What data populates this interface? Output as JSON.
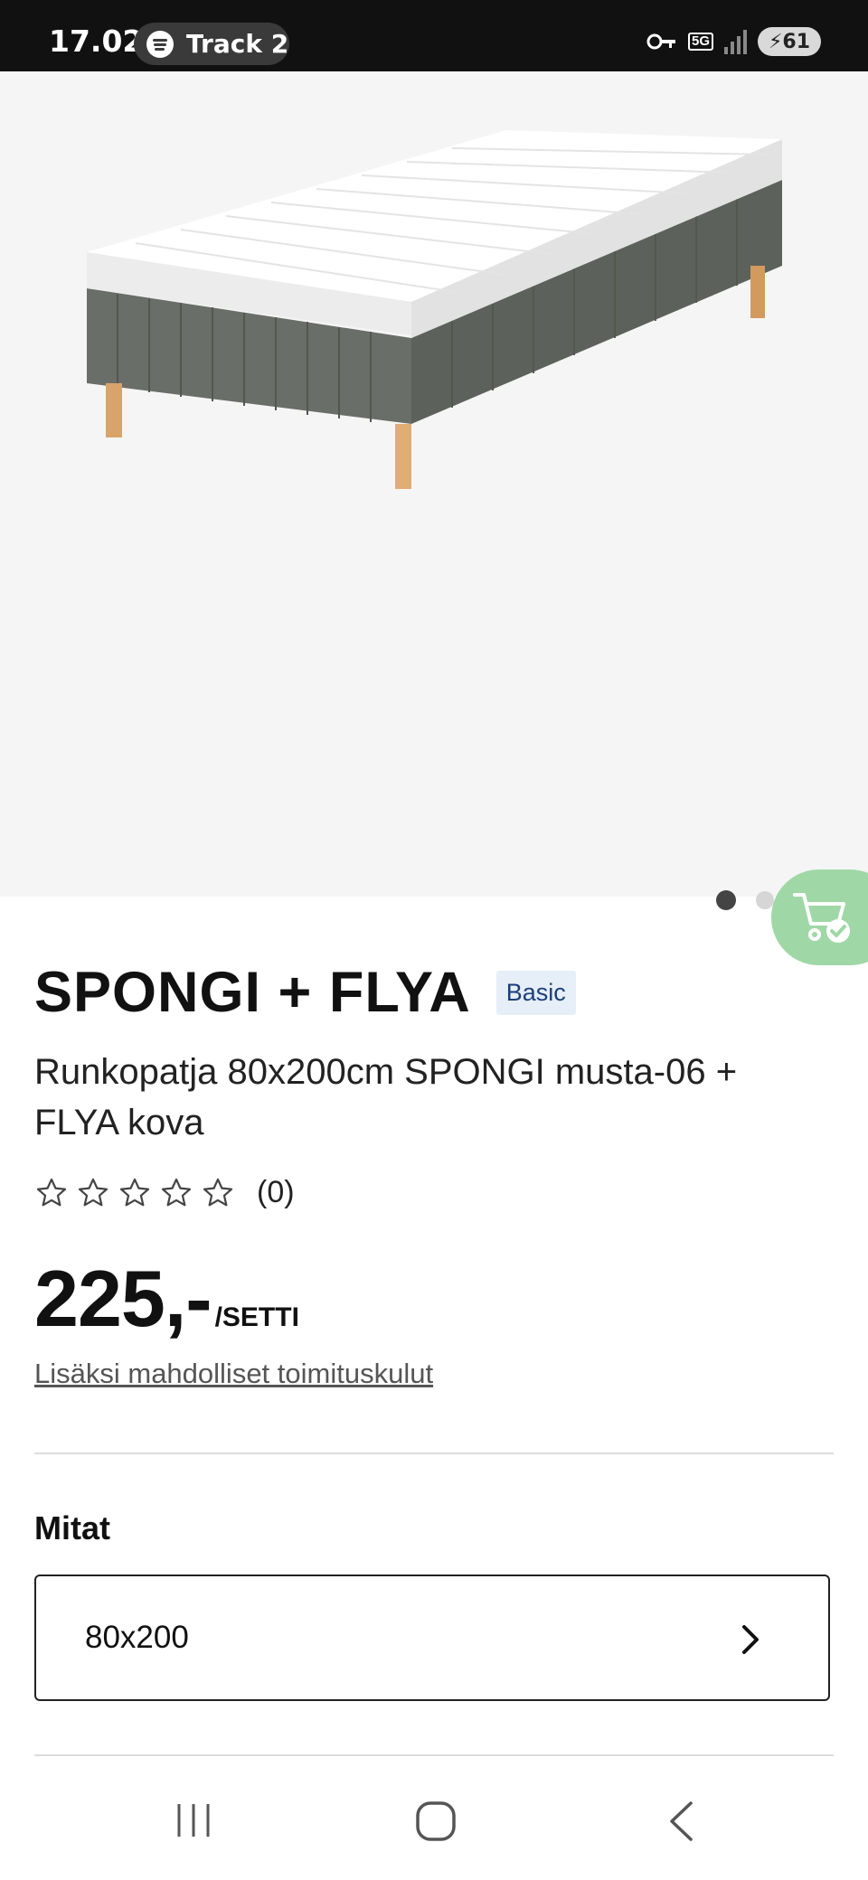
{
  "status_bar": {
    "time": "17.02",
    "media_label": "Track 2",
    "network": "5G",
    "battery": "61"
  },
  "gallery": {
    "image_alt": "bed",
    "dots_total": 3,
    "active_dot": 1
  },
  "product": {
    "title": "SPONGI + FLYA",
    "badge": "Basic",
    "subtitle": "Runkopatja 80x200cm SPONGI musta-06 + FLYA kova",
    "rating_stars": 0,
    "rating_max": 5,
    "review_count": "(0)",
    "price": "225,-",
    "price_unit": "/SETTI",
    "delivery_note": "Lisäksi mahdolliset toimituskulut"
  },
  "dimensions": {
    "label": "Mitat",
    "selected": "80x200"
  },
  "icons": {
    "cart": "cart-check-icon",
    "chevron": "chevron-right-icon",
    "star": "star-outline-icon"
  },
  "colors": {
    "cart_fab": "#9fd8a6",
    "badge_bg": "#e6eef8",
    "badge_text": "#1a3f7a"
  }
}
